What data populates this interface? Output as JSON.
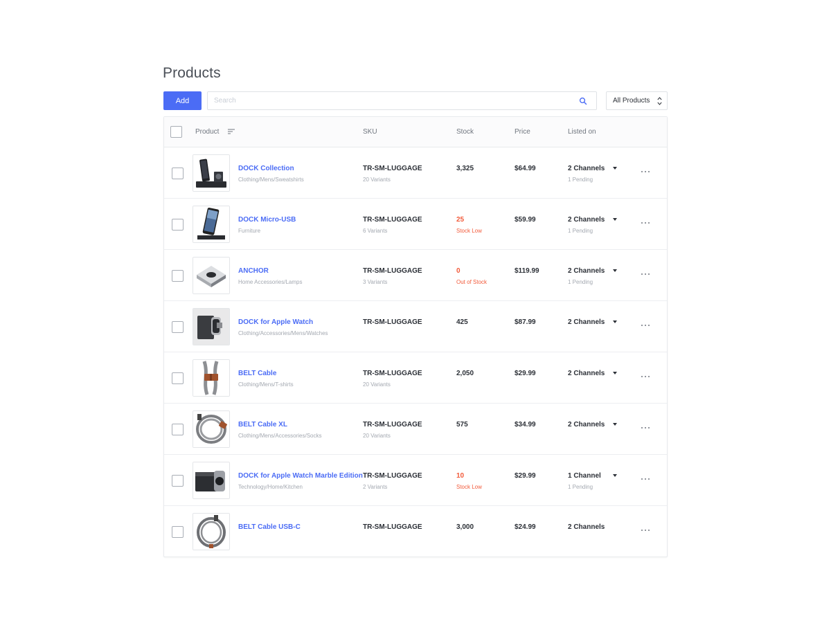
{
  "page": {
    "title": "Products"
  },
  "toolbar": {
    "add_label": "Add",
    "search_placeholder": "Search",
    "search_icon": "search-icon",
    "filter_value": "All Products"
  },
  "colors": {
    "accent": "#4b6cf5",
    "alert": "#f25a3a",
    "muted": "#a3a8b0",
    "text": "#2b2f36"
  },
  "table": {
    "columns": {
      "product": "Product",
      "sku": "SKU",
      "stock": "Stock",
      "price": "Price",
      "listed_on": "Listed on"
    },
    "rows": [
      {
        "name": "DOCK Collection",
        "category": "Clothing/Mens/Sweatshirts",
        "sku": "TR-SM-LUGGAGE",
        "variants": "20 Variants",
        "stock": "3,325",
        "stock_note": "",
        "price": "$64.99",
        "channels": "2 Channels",
        "pending": "1 Pending",
        "has_menu": true,
        "thumb": "dock-collection"
      },
      {
        "name": "DOCK Micro-USB",
        "category": "Furniture",
        "sku": "TR-SM-LUGGAGE",
        "variants": "6 Variants",
        "stock": "25",
        "stock_note": "Stock Low",
        "price": "$59.99",
        "channels": "2 Channels",
        "pending": "1 Pending",
        "has_menu": true,
        "thumb": "dock-phone"
      },
      {
        "name": "ANCHOR",
        "category": "Home Accessories/Lamps",
        "sku": "TR-SM-LUGGAGE",
        "variants": "3 Variants",
        "stock": "0",
        "stock_note": "Out of Stock",
        "price": "$119.99",
        "channels": "2 Channels",
        "pending": "1 Pending",
        "has_menu": true,
        "thumb": "anchor"
      },
      {
        "name": "DOCK for Apple Watch",
        "category": "Clothing/Accessories/Mens/Watches",
        "sku": "TR-SM-LUGGAGE",
        "variants": "",
        "stock": "425",
        "stock_note": "",
        "price": "$87.99",
        "channels": "2 Channels",
        "pending": "",
        "has_menu": true,
        "thumb": "watch-dock"
      },
      {
        "name": "BELT Cable",
        "category": "Clothing/Mens/T-shirts",
        "sku": "TR-SM-LUGGAGE",
        "variants": "20 Variants",
        "stock": "2,050",
        "stock_note": "",
        "price": "$29.99",
        "channels": "2 Channels",
        "pending": "",
        "has_menu": true,
        "thumb": "belt-cable"
      },
      {
        "name": "BELT Cable XL",
        "category": "Clothing/Mens/Accessories/Socks",
        "sku": "TR-SM-LUGGAGE",
        "variants": "20 Variants",
        "stock": "575",
        "stock_note": "",
        "price": "$34.99",
        "channels": "2 Channels",
        "pending": "",
        "has_menu": true,
        "thumb": "cable-coil"
      },
      {
        "name": "DOCK for Apple Watch Marble Edition",
        "category": "Technology/Home/Kitchen",
        "sku": "TR-SM-LUGGAGE",
        "variants": "2 Variants",
        "stock": "10",
        "stock_note": "Stock Low",
        "price": "$29.99",
        "channels": "1 Channel",
        "pending": "1 Pending",
        "has_menu": true,
        "thumb": "watch-marble"
      },
      {
        "name": "BELT Cable USB-C",
        "category": "",
        "sku": "TR-SM-LUGGAGE",
        "variants": "",
        "stock": "3,000",
        "stock_note": "",
        "price": "$24.99",
        "channels": "2 Channels",
        "pending": "",
        "has_menu": false,
        "thumb": "cable-coil-usbc"
      }
    ]
  }
}
